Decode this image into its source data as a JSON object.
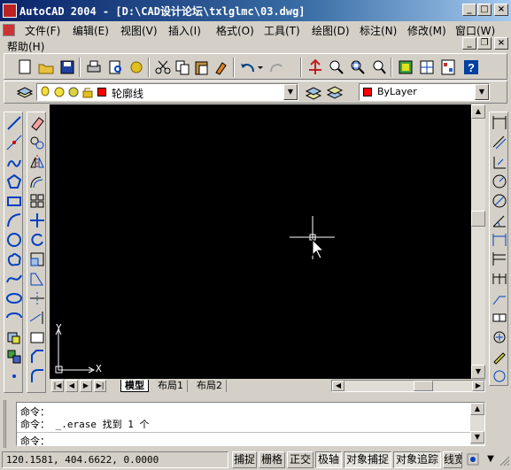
{
  "window": {
    "title": "AutoCAD 2004 - [D:\\CAD设计论坛\\txlglmc\\03.dwg]",
    "minimize": "_",
    "maximize": "□",
    "close": "×",
    "doc_minimize": "_",
    "doc_restore": "❐",
    "doc_close": "×"
  },
  "menu": [
    {
      "label": "文件(F)"
    },
    {
      "label": "编辑(E)"
    },
    {
      "label": "视图(V)"
    },
    {
      "label": "插入(I)"
    },
    {
      "label": "格式(O)"
    },
    {
      "label": "工具(T)"
    },
    {
      "label": "绘图(D)"
    },
    {
      "label": "标注(N)"
    },
    {
      "label": "修改(M)"
    },
    {
      "label": "窗口(W)"
    },
    {
      "label": "帮助(H)"
    }
  ],
  "layer": {
    "current": "轮廓线",
    "color_current": "ByLayer",
    "swatch": "#ff0000"
  },
  "layout_tabs": [
    {
      "label": "模型"
    },
    {
      "label": "布局1"
    },
    {
      "label": "布局2"
    }
  ],
  "command": {
    "lines": [
      "命令：",
      "命令： _.erase 找到 1 个"
    ],
    "prompt": "命令："
  },
  "status": {
    "coords": "120.1581, 404.6622, 0.0000",
    "buttons": [
      "捕捉",
      "栅格",
      "正交",
      "极轴",
      "对象捕捉",
      "对象追踪",
      "线宽"
    ]
  },
  "ucs": {
    "x": "X",
    "y": "Y"
  },
  "colors": {
    "canvas": "#000000",
    "titlebar": "#0a246a",
    "crosshair": "#ffffff"
  }
}
